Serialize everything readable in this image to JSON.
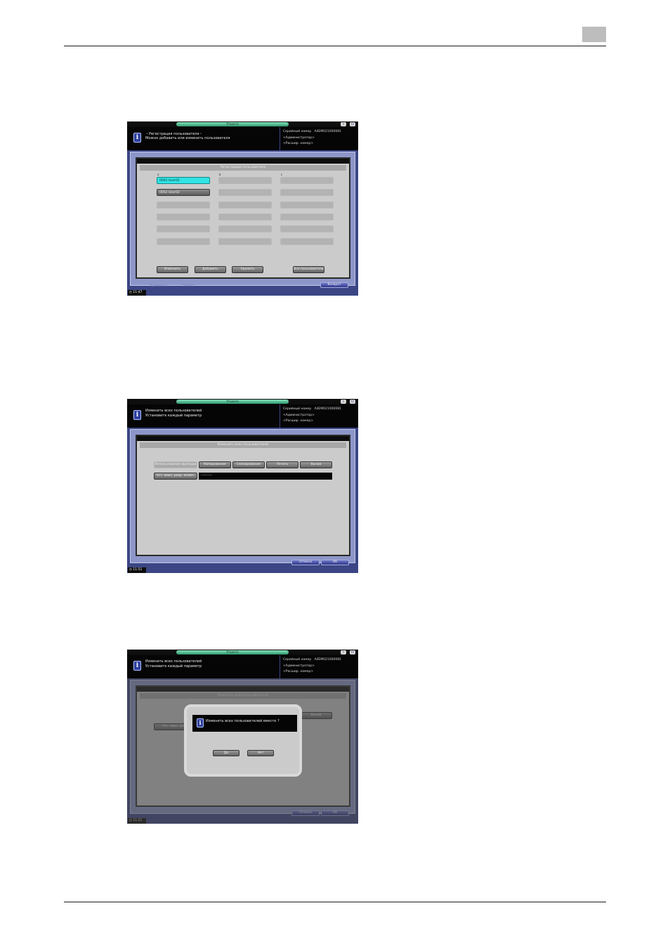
{
  "page": {
    "header_rule": true,
    "footer_rule": true
  },
  "shot1": {
    "title": "Утилита",
    "help_icon": "info-icon",
    "power_icon": "power-icon",
    "message": {
      "line1": "・Регистрация пользователя・",
      "line2": "Можно добавить или изменить пользователя"
    },
    "info": {
      "serial_label": "Серийный номер",
      "serial_value": "A4EM021000081",
      "role": "<Администратор>",
      "extra": "<Расшир. номер>"
    },
    "panel_title": "Регистрация пользователя",
    "columns": [
      "a",
      "b",
      "c"
    ],
    "users": [
      {
        "label": "0001 User01",
        "state": "selected"
      },
      {
        "label": "0002 User02",
        "state": "used"
      }
    ],
    "buttons": {
      "edit": "Изменить",
      "add": "Добавить",
      "delete": "Удалить",
      "all_users": "Все пользователи"
    },
    "footer": {
      "clock": "11:47",
      "ghost1": "Применить",
      "ghost2": "Отмена",
      "back": "Возврат"
    }
  },
  "shot2": {
    "title": "Утилита",
    "help_icon": "info-icon",
    "power_icon": "power-icon",
    "message": {
      "line1": "Изменить всех пользователей",
      "line2": "Установите каждый параметр"
    },
    "info": {
      "serial_label": "Серийный номер",
      "serial_value": "A4EM021000081",
      "role": "<Администратор>",
      "extra": "<Расшир. номер>"
    },
    "panel_title": "Изменить всех пользователей",
    "func_label": "Использование функции",
    "func_buttons": [
      "Копирование",
      "Сканирование",
      "Печать",
      "Вызов"
    ],
    "limit_label": "Уст. макс. разр. колич.",
    "limit_value": "----------",
    "footer": {
      "clock": "11:51",
      "cancel": "Отмена",
      "ok": "OK"
    }
  },
  "shot3": {
    "title": "Утилита",
    "help_icon": "info-icon",
    "power_icon": "power-icon",
    "message": {
      "line1": "Изменить всех пользователей",
      "line2": "Установите каждый параметр"
    },
    "info": {
      "serial_label": "Серийный номер",
      "serial_value": "A4EM021000081",
      "role": "<Администратор>",
      "extra": "<Расшир. номер>"
    },
    "panel_title": "Изменить всех пользователей",
    "bg_label_left": "Уст. макс. разр.",
    "bg_label_right": "Вызов",
    "dialog": {
      "question": "Изменить всех пользователей вместе ?",
      "yes": "Да",
      "no": "Нет"
    },
    "footer": {
      "clock": "11:51",
      "cancel": "Отмена",
      "ok": "OK"
    }
  }
}
